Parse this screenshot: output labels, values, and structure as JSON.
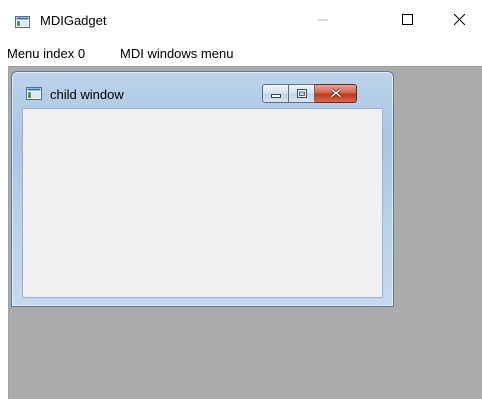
{
  "window": {
    "title": "MDIGadget"
  },
  "menu": {
    "items": [
      {
        "label": "Menu index 0"
      },
      {
        "label": "MDI windows menu"
      }
    ]
  },
  "child_window": {
    "title": "child window"
  },
  "colors": {
    "mdi_background": "#ababab",
    "child_frame": "#a9c6e6",
    "child_client": "#f0f0f0",
    "close_button": "#c4341c"
  },
  "icons": {
    "app": "window-app-icon",
    "minimize": "minimize-icon",
    "maximize": "maximize-icon",
    "close": "close-icon",
    "child_app": "window-app-icon",
    "child_minimize": "minimize-icon",
    "child_restore": "restore-icon",
    "child_close": "close-icon"
  }
}
